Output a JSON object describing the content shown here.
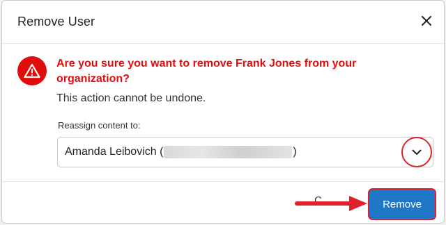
{
  "dialog": {
    "title": "Remove User",
    "close_icon": "close-icon"
  },
  "warning": {
    "icon": "warning-triangle-icon",
    "heading": "Are you sure you want to remove Frank Jones from your organization?",
    "subtext": "This action cannot be undone."
  },
  "reassign": {
    "label": "Reassign content to:",
    "selected_name": "Amanda Leibovich (",
    "selected_suffix": ")",
    "chevron_icon": "chevron-down-icon"
  },
  "footer": {
    "cancel_label": "C",
    "remove_label": "Remove"
  },
  "colors": {
    "warning_red": "#e00d0d",
    "primary_blue": "#1f77c8",
    "highlight_red": "#e0202a"
  }
}
